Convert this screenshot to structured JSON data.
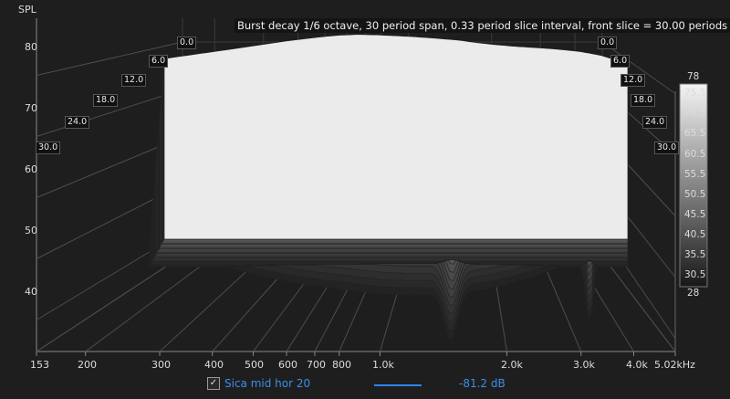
{
  "chart_data": {
    "type": "area",
    "title": "Burst decay 1/6 octave, 30 period span, 0.33 period slice interval,  front slice = 30.00 periods",
    "ylabel": "SPL",
    "xlabel": "",
    "x_scale": "log",
    "xlim": [
      153,
      5020
    ],
    "ylim": [
      35,
      83
    ],
    "x_ticks": [
      "153",
      "200",
      "300",
      "400",
      "500",
      "600",
      "700",
      "800",
      "1.0k",
      "2.0k",
      "3.0k",
      "4.0k",
      "5.02kHz"
    ],
    "x_tick_values": [
      153,
      200,
      300,
      400,
      500,
      600,
      700,
      800,
      1000,
      2000,
      3000,
      4000,
      5020
    ],
    "y_ticks": [
      "80",
      "70",
      "60",
      "50",
      "40"
    ],
    "y_tick_values": [
      80,
      70,
      60,
      50,
      40
    ],
    "slice_labels_left": [
      "0.0",
      "6.0",
      "12.0",
      "18.0",
      "24.0",
      "30.0"
    ],
    "slice_labels_right": [
      "0.0",
      "6.0",
      "12.0",
      "18.0",
      "24.0",
      "30.0"
    ],
    "colorbar": {
      "max": "78",
      "min": "28",
      "ticks": [
        "75.5",
        "70.5",
        "65.5",
        "60.5",
        "55.5",
        "50.5",
        "45.5",
        "40.5",
        "35.5",
        "30.5"
      ]
    },
    "front_slice_response": {
      "x": [
        300,
        400,
        500,
        600,
        700,
        800,
        900,
        1000,
        1200,
        1400,
        1600,
        1800,
        2000,
        2200,
        2500,
        2800,
        3200,
        3600,
        4000
      ],
      "y": [
        76.5,
        78.0,
        79.2,
        80.2,
        80.9,
        81.4,
        81.6,
        81.5,
        81.2,
        80.8,
        80.4,
        79.8,
        79.4,
        79.1,
        78.8,
        78.5,
        78.0,
        77.2,
        76.0
      ]
    },
    "series": [
      {
        "name": "Sica mid hor 20",
        "value_label": "-81.2 dB",
        "color": "#2d86ea"
      }
    ]
  },
  "legend": {
    "checked": "✓",
    "name": "Sica mid hor 20",
    "value": "-81.2 dB"
  }
}
